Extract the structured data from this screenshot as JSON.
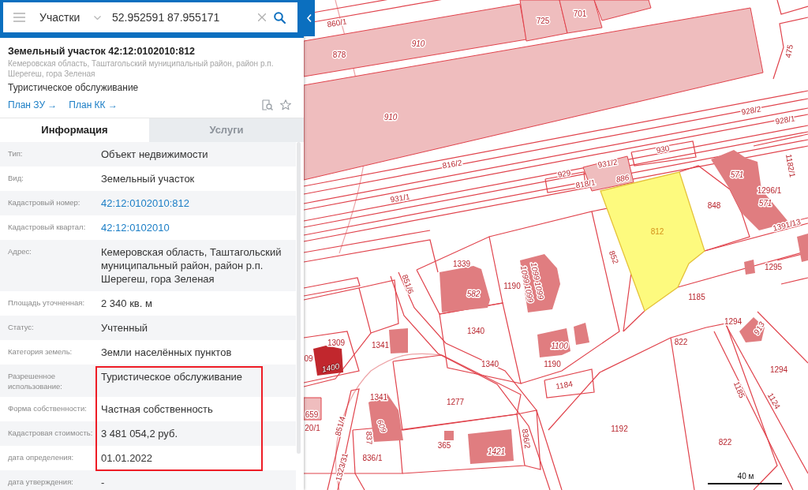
{
  "search": {
    "layer": "Участки",
    "query": "52.952591 87.955171"
  },
  "object": {
    "title": "Земельный участок 42:12:0102010:812",
    "address": "Кемеровская область, Таштагольский муниципальный район, район р.п. Шерегеш, гора Зеленая",
    "usage": "Туристическое обслуживание",
    "links": [
      "План ЗУ →",
      "План КК →"
    ]
  },
  "tabs": [
    {
      "label": "Информация",
      "selected": true
    },
    {
      "label": "Услуги",
      "selected": false
    }
  ],
  "info_rows": [
    {
      "label": "Тип:",
      "value": "Объект недвижимости",
      "kind": "text",
      "highlighted": false
    },
    {
      "label": "Вид:",
      "value": "Земельный участок",
      "kind": "text",
      "highlighted": false
    },
    {
      "label": "Кадастровый номер:",
      "value": "42:12:0102010:812",
      "kind": "link",
      "highlighted": false
    },
    {
      "label": "Кадастровый квартал:",
      "value": "42:12:0102010",
      "kind": "link",
      "highlighted": false
    },
    {
      "label": "Адрес:",
      "value": "Кемеровская область, Таштагольский муниципальный район, район р.п. Шерегеш, гора Зеленая",
      "kind": "text",
      "highlighted": false
    },
    {
      "label": "Площадь уточненная:",
      "value": "2 340 кв. м",
      "kind": "text",
      "highlighted": false
    },
    {
      "label": "Статус:",
      "value": "Учтенный",
      "kind": "text",
      "highlighted": false
    },
    {
      "label": "Категория земель:",
      "value": "Земли населённых пунктов",
      "kind": "text",
      "highlighted": false
    },
    {
      "label": "Разрешенное использование:",
      "value": "Туристическое обслуживание",
      "kind": "text",
      "highlighted": true
    },
    {
      "label": "Форма собственности:",
      "value": "Частная собственность",
      "kind": "text",
      "highlighted": true
    },
    {
      "label": "Кадастровая стоимость:",
      "value": "3 481 054,2 руб.",
      "kind": "text",
      "highlighted": true
    },
    {
      "label": "дата определения:",
      "value": "01.01.2022",
      "kind": "text",
      "highlighted": true
    },
    {
      "label": "дата утверждения:",
      "value": "-",
      "kind": "text",
      "highlighted": false
    }
  ],
  "map": {
    "parcel_labels": [
      {
        "text": "860/1",
        "kind": "parcel"
      },
      {
        "text": "725",
        "kind": "parcel"
      },
      {
        "text": "701",
        "kind": "parcel"
      },
      {
        "text": "878",
        "kind": "parcel"
      },
      {
        "text": "910",
        "kind": "object"
      },
      {
        "text": "910",
        "kind": "object"
      },
      {
        "text": "475",
        "kind": "parcel"
      },
      {
        "text": "928/2",
        "kind": "parcel"
      },
      {
        "text": "928/1",
        "kind": "parcel"
      },
      {
        "text": "930",
        "kind": "parcel"
      },
      {
        "text": "816/2",
        "kind": "parcel"
      },
      {
        "text": "931/2",
        "kind": "parcel"
      },
      {
        "text": "929",
        "kind": "parcel"
      },
      {
        "text": "886",
        "kind": "object"
      },
      {
        "text": "818/1",
        "kind": "parcel"
      },
      {
        "text": "931/1",
        "kind": "parcel"
      },
      {
        "text": "848",
        "kind": "parcel"
      },
      {
        "text": "571",
        "kind": "object"
      },
      {
        "text": "1296/1",
        "kind": "parcel"
      },
      {
        "text": "571",
        "kind": "object"
      },
      {
        "text": "1182/1",
        "kind": "parcel"
      },
      {
        "text": "1391/13",
        "kind": "parcel"
      },
      {
        "text": "852",
        "kind": "parcel"
      },
      {
        "text": "1339",
        "kind": "parcel"
      },
      {
        "text": "582",
        "kind": "object"
      },
      {
        "text": "1190",
        "kind": "parcel"
      },
      {
        "text": "1099 1099",
        "kind": "object"
      },
      {
        "text": "1099 1099",
        "kind": "object"
      },
      {
        "text": "851/6",
        "kind": "parcel"
      },
      {
        "text": "1295",
        "kind": "parcel"
      },
      {
        "text": "1185",
        "kind": "parcel"
      },
      {
        "text": "1294",
        "kind": "parcel"
      },
      {
        "text": "913",
        "kind": "object"
      },
      {
        "text": "1340",
        "kind": "parcel"
      },
      {
        "text": "1100",
        "kind": "object"
      },
      {
        "text": "1340",
        "kind": "parcel"
      },
      {
        "text": "1190",
        "kind": "parcel"
      },
      {
        "text": "1309",
        "kind": "parcel"
      },
      {
        "text": "09",
        "kind": "parcel"
      },
      {
        "text": "1400",
        "kind": "object"
      },
      {
        "text": "1341",
        "kind": "parcel"
      },
      {
        "text": "822",
        "kind": "parcel"
      },
      {
        "text": "1294",
        "kind": "parcel"
      },
      {
        "text": "1184",
        "kind": "parcel"
      },
      {
        "text": "1185",
        "kind": "parcel"
      },
      {
        "text": "1124",
        "kind": "parcel"
      },
      {
        "text": "1341",
        "kind": "parcel"
      },
      {
        "text": "1277",
        "kind": "parcel"
      },
      {
        "text": "659",
        "kind": "parcel"
      },
      {
        "text": "20/1",
        "kind": "parcel"
      },
      {
        "text": "851/4",
        "kind": "parcel"
      },
      {
        "text": "609",
        "kind": "object"
      },
      {
        "text": "836/2",
        "kind": "parcel"
      },
      {
        "text": "1192",
        "kind": "parcel"
      },
      {
        "text": "822",
        "kind": "parcel"
      },
      {
        "text": "837",
        "kind": "parcel"
      },
      {
        "text": "365",
        "kind": "parcel"
      },
      {
        "text": "1421",
        "kind": "object"
      },
      {
        "text": "836/1",
        "kind": "parcel"
      },
      {
        "text": "1323/31",
        "kind": "parcel"
      }
    ],
    "selected_parcel": {
      "label": "812"
    },
    "scale": "40 м"
  }
}
